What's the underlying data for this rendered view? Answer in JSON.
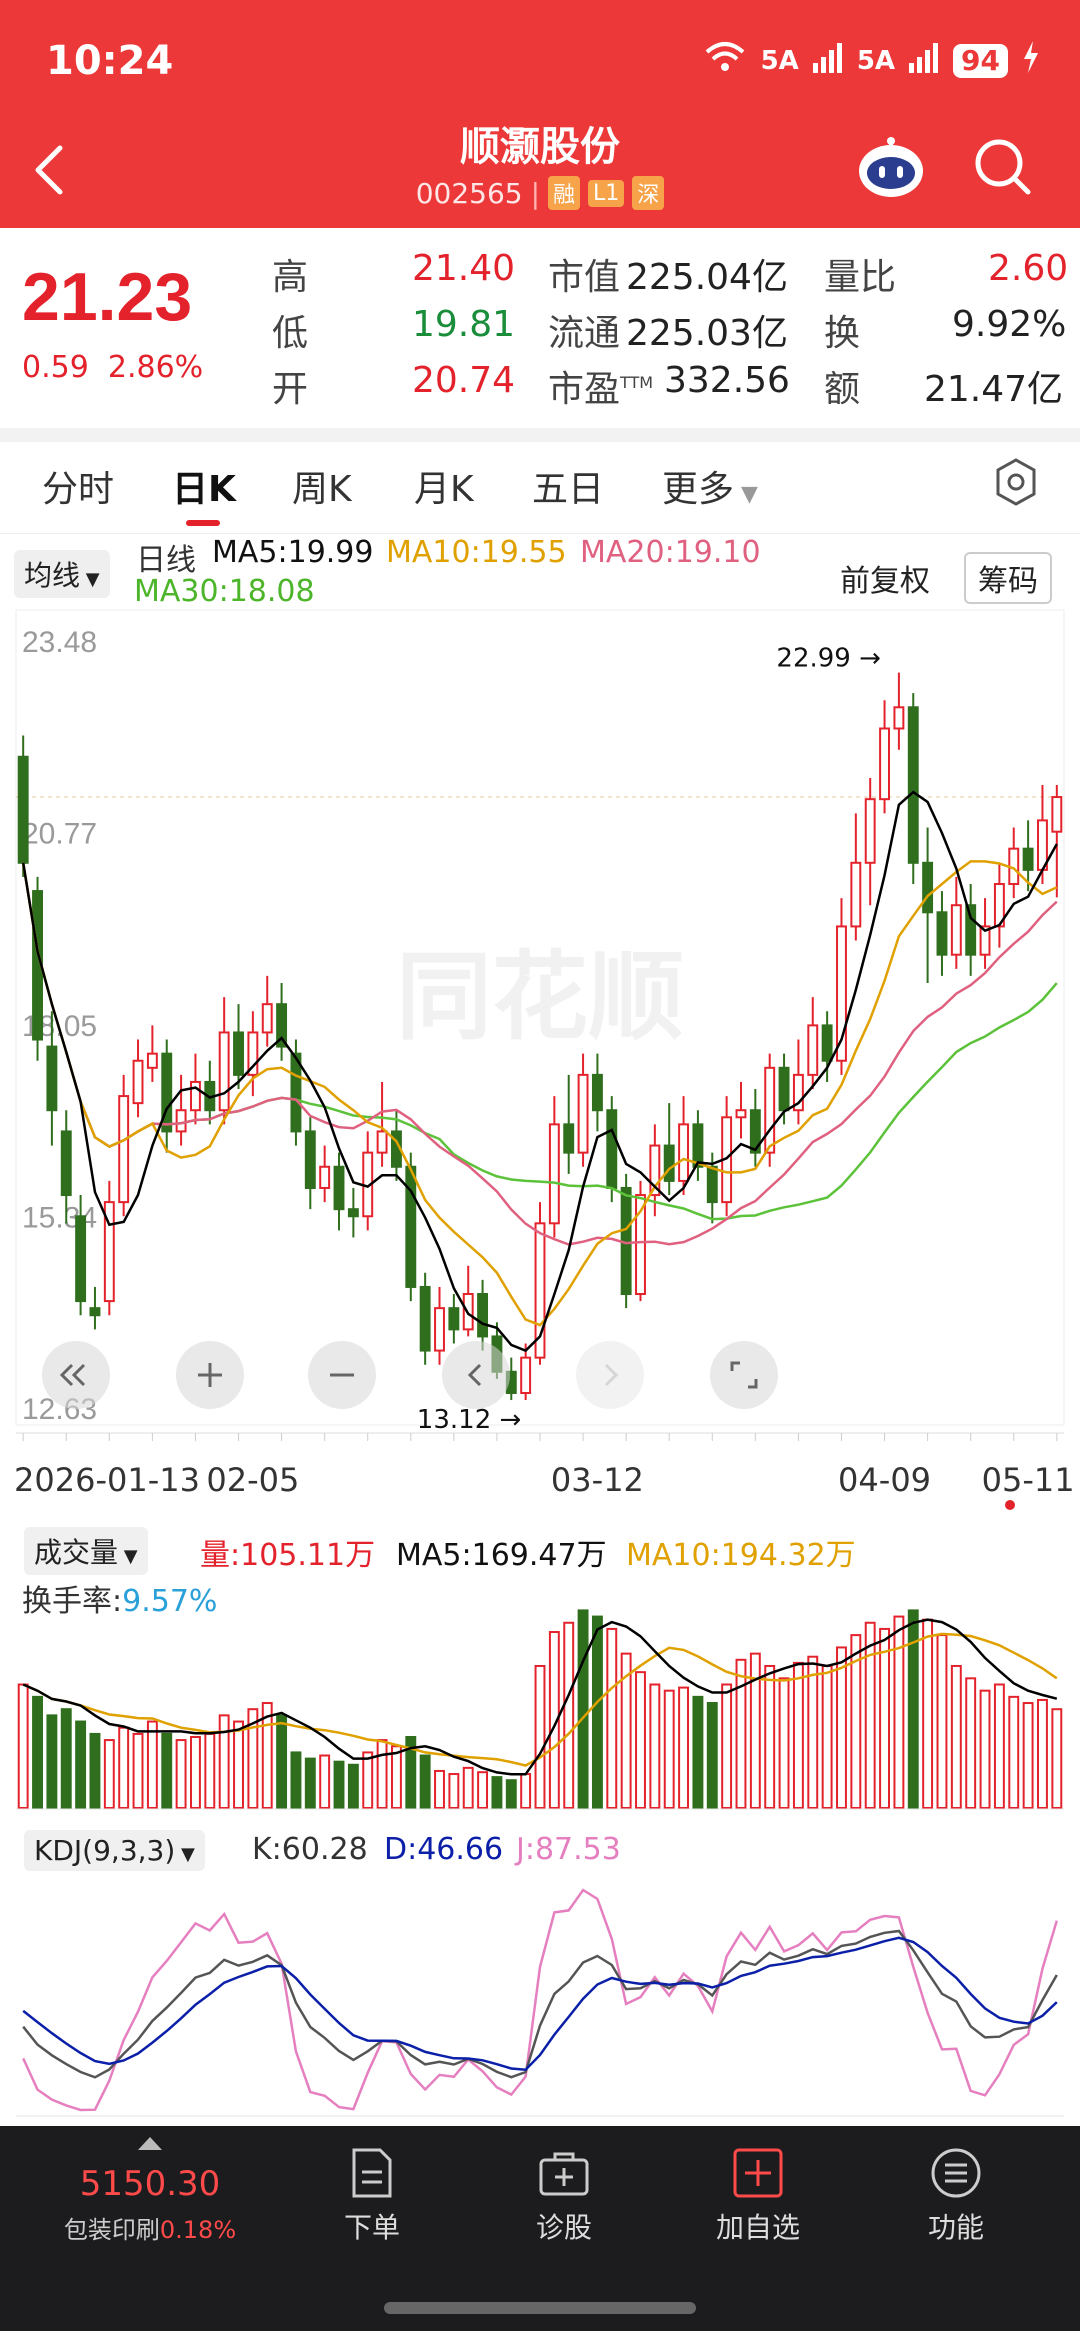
{
  "status": {
    "time": "10:24",
    "signal1": "5A",
    "signal2": "5A",
    "battery": "94"
  },
  "header": {
    "name": "顺灏股份",
    "code": "002565",
    "tags": [
      "融",
      "L1",
      "深"
    ]
  },
  "quote": {
    "price": "21.23",
    "change": "0.59",
    "change_pct": "2.86%",
    "rows": [
      {
        "k1": "高",
        "v1": "21.40",
        "k2": "市值",
        "v2": "225.04亿",
        "k3": "量比",
        "v3": "2.60"
      },
      {
        "k1": "低",
        "v1": "19.81",
        "k2": "流通",
        "v2": "225.03亿",
        "k3": "换",
        "v3": "9.92%"
      },
      {
        "k1": "开",
        "v1": "20.74",
        "k2": "市盈",
        "v2": "332.56",
        "k3": "额",
        "v3": "21.47亿"
      }
    ],
    "pe_sup": "TTM"
  },
  "tabs": [
    "分时",
    "日K",
    "周K",
    "月K",
    "五日",
    "更多"
  ],
  "kline": {
    "selector": "均线",
    "period": "日线",
    "ma5": "MA5:19.99",
    "ma10": "MA10:19.55",
    "ma20": "MA20:19.10",
    "ma30": "MA30:18.08",
    "adjust": "前复权",
    "chips": "筹码",
    "y_labels": [
      "23.48",
      "20.77",
      "18.05",
      "15.34",
      "12.63"
    ],
    "high_mark": "22.99",
    "low_mark": "13.12",
    "dates": [
      "2026-01-13",
      "02-05",
      "03-12",
      "04-09",
      "05-11"
    ],
    "watermark": "同花顺"
  },
  "volume": {
    "selector": "成交量",
    "vol": "量:105.11万",
    "ma5": "MA5:169.47万",
    "ma10": "MA10:194.32万",
    "turnover_label": "换手率:",
    "turnover": "9.57%"
  },
  "kdj": {
    "selector": "KDJ(9,3,3)",
    "k": "K:60.28",
    "d": "D:46.66",
    "j": "J:87.53"
  },
  "nav": {
    "index_value": "5150.30",
    "index_name": "包装印刷",
    "index_pct": "0.18%",
    "items": [
      "下单",
      "诊股",
      "加自选",
      "功能"
    ]
  },
  "colors": {
    "up": "#e4222b",
    "down": "#2f6e1d",
    "header": "#ec3838",
    "ma5": "#000000",
    "ma10": "#e0a100",
    "ma20": "#e06080",
    "ma30": "#5cc23a"
  },
  "chart_data": {
    "type": "candlestick",
    "ylim": [
      12.63,
      23.48
    ],
    "x_tick_labels": [
      "2026-01-13",
      "02-05",
      "03-12",
      "04-09",
      "05-11"
    ],
    "candles": [
      [
        21.8,
        20.3,
        22.1,
        20.1
      ],
      [
        19.9,
        17.8,
        20.1,
        17.5
      ],
      [
        17.7,
        16.8,
        18.2,
        16.3
      ],
      [
        16.5,
        15.6,
        16.8,
        15.2
      ],
      [
        15.3,
        14.1,
        15.6,
        13.9
      ],
      [
        14.0,
        13.9,
        14.3,
        13.7
      ],
      [
        14.1,
        15.5,
        15.8,
        13.9
      ],
      [
        15.5,
        17.0,
        17.3,
        15.3
      ],
      [
        16.9,
        17.5,
        17.8,
        16.7
      ],
      [
        17.4,
        17.6,
        18.0,
        17.2
      ],
      [
        17.6,
        16.5,
        17.8,
        16.2
      ],
      [
        16.5,
        16.8,
        17.3,
        16.3
      ],
      [
        16.8,
        17.2,
        17.6,
        16.6
      ],
      [
        17.2,
        16.8,
        17.5,
        16.6
      ],
      [
        16.8,
        17.9,
        18.4,
        16.6
      ],
      [
        17.9,
        17.3,
        18.3,
        17.1
      ],
      [
        17.3,
        17.9,
        18.2,
        17.0
      ],
      [
        17.9,
        18.3,
        18.7,
        17.7
      ],
      [
        18.3,
        17.7,
        18.6,
        17.5
      ],
      [
        17.6,
        16.5,
        17.8,
        16.3
      ],
      [
        16.5,
        15.7,
        16.7,
        15.4
      ],
      [
        15.7,
        16.0,
        16.3,
        15.5
      ],
      [
        16.0,
        15.4,
        16.2,
        15.1
      ],
      [
        15.4,
        15.3,
        15.7,
        15.0
      ],
      [
        15.3,
        16.2,
        16.5,
        15.1
      ],
      [
        16.2,
        16.5,
        17.2,
        16.0
      ],
      [
        16.5,
        16.0,
        16.8,
        15.8
      ],
      [
        16.0,
        14.3,
        16.2,
        14.1
      ],
      [
        14.3,
        13.4,
        14.5,
        13.2
      ],
      [
        13.4,
        14.0,
        14.3,
        13.2
      ],
      [
        14.0,
        13.7,
        14.2,
        13.5
      ],
      [
        13.7,
        14.2,
        14.6,
        13.6
      ],
      [
        14.2,
        13.6,
        14.4,
        13.4
      ],
      [
        13.6,
        13.1,
        13.8,
        13.0
      ],
      [
        13.1,
        12.8,
        13.3,
        12.7
      ],
      [
        12.8,
        13.3,
        13.5,
        12.7
      ],
      [
        13.3,
        15.2,
        15.5,
        13.2
      ],
      [
        15.2,
        16.6,
        17.0,
        15.0
      ],
      [
        16.6,
        16.2,
        17.3,
        15.9
      ],
      [
        16.2,
        17.3,
        17.6,
        16.0
      ],
      [
        17.3,
        16.8,
        17.6,
        16.5
      ],
      [
        16.8,
        15.7,
        17.0,
        15.5
      ],
      [
        15.7,
        14.2,
        15.9,
        14.0
      ],
      [
        14.2,
        15.6,
        15.8,
        14.1
      ],
      [
        15.6,
        16.3,
        16.6,
        15.3
      ],
      [
        16.3,
        15.8,
        16.9,
        15.6
      ],
      [
        15.8,
        16.6,
        17.0,
        15.6
      ],
      [
        16.6,
        16.0,
        16.8,
        15.8
      ],
      [
        16.0,
        15.5,
        16.2,
        15.2
      ],
      [
        15.5,
        16.7,
        17.0,
        15.3
      ],
      [
        16.7,
        16.8,
        17.2,
        16.4
      ],
      [
        16.8,
        16.2,
        17.1,
        16.0
      ],
      [
        16.2,
        17.4,
        17.6,
        16.0
      ],
      [
        17.4,
        16.8,
        17.6,
        16.6
      ],
      [
        16.8,
        17.3,
        17.8,
        16.6
      ],
      [
        17.3,
        18.0,
        18.4,
        17.1
      ],
      [
        18.0,
        17.5,
        18.2,
        17.2
      ],
      [
        17.5,
        19.4,
        19.8,
        17.3
      ],
      [
        19.4,
        20.3,
        21.0,
        19.2
      ],
      [
        20.3,
        21.2,
        21.5,
        19.7
      ],
      [
        21.2,
        22.2,
        22.6,
        21.0
      ],
      [
        22.2,
        22.5,
        22.99,
        21.9
      ],
      [
        22.5,
        20.3,
        22.7,
        20.0
      ],
      [
        20.3,
        19.6,
        20.8,
        18.6
      ],
      [
        19.6,
        19.0,
        19.9,
        18.7
      ],
      [
        19.0,
        19.7,
        20.1,
        18.8
      ],
      [
        19.7,
        19.0,
        20.0,
        18.7
      ],
      [
        19.0,
        19.4,
        19.8,
        18.8
      ],
      [
        19.4,
        20.0,
        20.3,
        19.1
      ],
      [
        20.0,
        20.5,
        20.8,
        19.8
      ],
      [
        20.5,
        20.2,
        20.9,
        19.9
      ],
      [
        20.2,
        20.9,
        21.4,
        20.0
      ],
      [
        20.74,
        21.23,
        21.4,
        19.81
      ]
    ],
    "volume": [
      [
        1,
        200
      ],
      [
        0,
        180
      ],
      [
        0,
        150
      ],
      [
        0,
        160
      ],
      [
        0,
        140
      ],
      [
        0,
        120
      ],
      [
        1,
        110
      ],
      [
        1,
        130
      ],
      [
        1,
        120
      ],
      [
        1,
        140
      ],
      [
        0,
        120
      ],
      [
        1,
        110
      ],
      [
        1,
        115
      ],
      [
        1,
        120
      ],
      [
        1,
        150
      ],
      [
        1,
        140
      ],
      [
        1,
        160
      ],
      [
        1,
        170
      ],
      [
        0,
        150
      ],
      [
        0,
        90
      ],
      [
        0,
        80
      ],
      [
        1,
        85
      ],
      [
        0,
        75
      ],
      [
        0,
        70
      ],
      [
        1,
        90
      ],
      [
        1,
        110
      ],
      [
        1,
        100
      ],
      [
        0,
        115
      ],
      [
        0,
        85
      ],
      [
        1,
        60
      ],
      [
        1,
        55
      ],
      [
        1,
        65
      ],
      [
        1,
        58
      ],
      [
        0,
        50
      ],
      [
        0,
        45
      ],
      [
        1,
        55
      ],
      [
        1,
        230
      ],
      [
        1,
        285
      ],
      [
        1,
        300
      ],
      [
        0,
        320
      ],
      [
        0,
        310
      ],
      [
        1,
        290
      ],
      [
        1,
        250
      ],
      [
        1,
        220
      ],
      [
        1,
        200
      ],
      [
        1,
        190
      ],
      [
        1,
        195
      ],
      [
        0,
        180
      ],
      [
        0,
        170
      ],
      [
        1,
        200
      ],
      [
        1,
        240
      ],
      [
        1,
        250
      ],
      [
        1,
        230
      ],
      [
        1,
        210
      ],
      [
        1,
        235
      ],
      [
        1,
        245
      ],
      [
        1,
        230
      ],
      [
        1,
        260
      ],
      [
        1,
        280
      ],
      [
        1,
        300
      ],
      [
        1,
        290
      ],
      [
        1,
        310
      ],
      [
        0,
        320
      ],
      [
        1,
        305
      ],
      [
        1,
        280
      ],
      [
        1,
        230
      ],
      [
        1,
        210
      ],
      [
        1,
        190
      ],
      [
        1,
        200
      ],
      [
        1,
        180
      ],
      [
        1,
        170
      ],
      [
        1,
        175
      ],
      [
        1,
        160
      ]
    ]
  }
}
